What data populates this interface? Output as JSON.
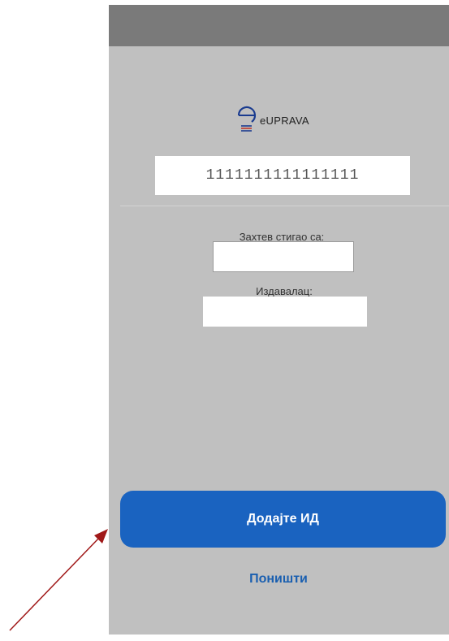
{
  "logo": {
    "text": "eUPRAVA",
    "accent": "#1a3b8f",
    "stripe_color": "#c0392b"
  },
  "id_field": {
    "value": "1111111111111111"
  },
  "request_from": {
    "label": "Захтев стигао са:",
    "value": ""
  },
  "issuer": {
    "label": "Издавалац:",
    "value": ""
  },
  "actions": {
    "add_label": "Додајте ИД",
    "cancel_label": "Поништи"
  },
  "colors": {
    "primary": "#1a63c0",
    "link": "#1a5fb0",
    "screen_bg": "#c0c0c0",
    "status_bar": "#7a7a7a",
    "annotation_arrow": "#a01818"
  },
  "annotation": {
    "icon": "arrow-pointer-icon"
  }
}
